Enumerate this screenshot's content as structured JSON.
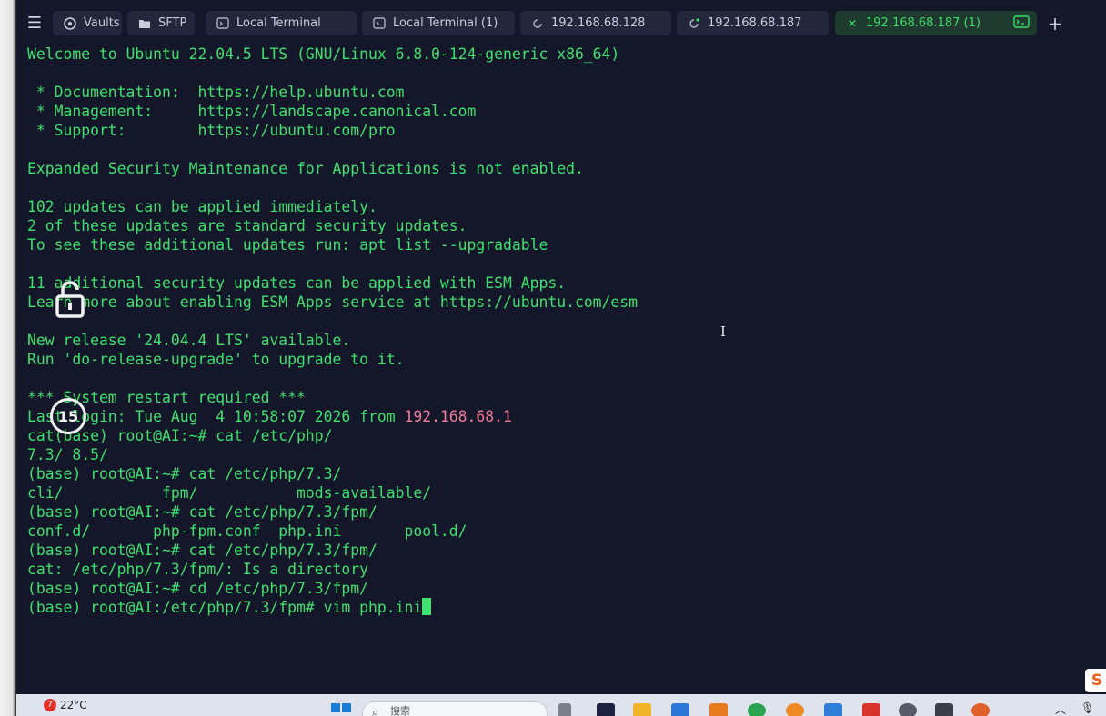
{
  "tabs": [
    {
      "label": "Vaults",
      "icon": "vault-icon"
    },
    {
      "label": "SFTP",
      "icon": "folder-icon"
    },
    {
      "label": "Local Terminal",
      "icon": "terminal-icon"
    },
    {
      "label": "Local Terminal (1)",
      "icon": "terminal-icon"
    },
    {
      "label": "192.168.68.128",
      "icon": "connecting-icon"
    },
    {
      "label": "192.168.68.187",
      "icon": "connecting-icon"
    },
    {
      "label": "192.168.68.187 (1)",
      "icon": "close-icon",
      "active": true
    }
  ],
  "terminal": {
    "lines": [
      "Welcome to Ubuntu 22.04.5 LTS (GNU/Linux 6.8.0-124-generic x86_64)",
      "",
      " * Documentation:  https://help.ubuntu.com",
      " * Management:     https://landscape.canonical.com",
      " * Support:        https://ubuntu.com/pro",
      "",
      "Expanded Security Maintenance for Applications is not enabled.",
      "",
      "102 updates can be applied immediately.",
      "2 of these updates are standard security updates.",
      "To see these additional updates run: apt list --upgradable",
      "",
      "11 additional security updates can be applied with ESM Apps.",
      "Learn more about enabling ESM Apps service at https://ubuntu.com/esm",
      "",
      "New release '24.04.4 LTS' available.",
      "Run 'do-release-upgrade' to upgrade to it.",
      "",
      "*** System restart required ***"
    ],
    "last_login_prefix": "Last login: Tue Aug  4 10:58:07 2026 from ",
    "last_login_ip": "192.168.68.1",
    "after_lines": [
      "cat(base) root@AI:~# cat /etc/php/",
      "7.3/ 8.5/",
      "(base) root@AI:~# cat /etc/php/7.3/",
      "cli/           fpm/           mods-available/",
      "(base) root@AI:~# cat /etc/php/7.3/fpm/",
      "conf.d/       php-fpm.conf  php.ini       pool.d/",
      "(base) root@AI:~# cat /etc/php/7.3/fpm/",
      "cat: /etc/php/7.3/fpm/: Is a directory",
      "(base) root@AI:~# cd /etc/php/7.3/fpm/"
    ],
    "current_prompt": "(base) root@AI:/etc/php/7.3/fpm# vim php.ini"
  },
  "overlay": {
    "timer_value": "15"
  },
  "side_badge": "S",
  "taskbar": {
    "weather_badge": "7",
    "weather_temp": "22°C",
    "search_placeholder": "搜索"
  },
  "colors": {
    "terminal_fg": "#3fe06e",
    "ip": "#f07a9a",
    "bg": "#141729"
  }
}
